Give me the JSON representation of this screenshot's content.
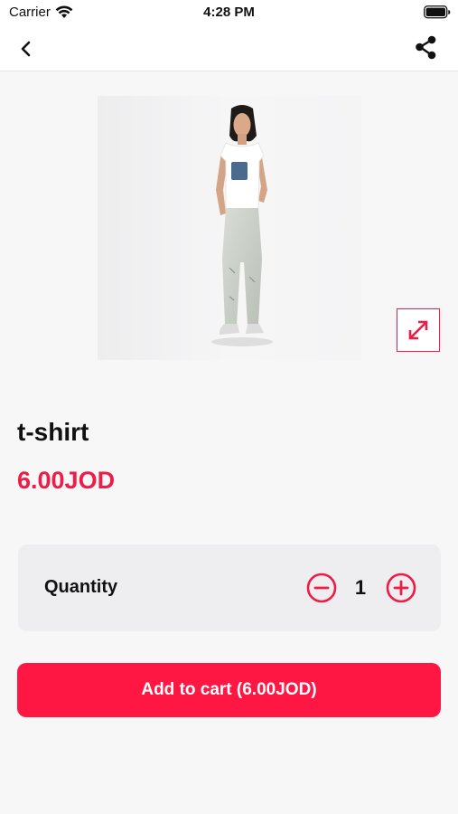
{
  "status_bar": {
    "carrier": "Carrier",
    "time": "4:28 PM",
    "icons": [
      "wifi-icon",
      "battery-icon"
    ]
  },
  "nav": {
    "back_icon": "chevron-left-icon",
    "share_icon": "share-icon"
  },
  "product": {
    "image": "model wearing white t-shirt with denim pocket and light ripped jeans",
    "expand_icon": "expand-arrows-icon",
    "title": "t-shirt",
    "price": "6.00JOD"
  },
  "quantity": {
    "label": "Quantity",
    "value": "1",
    "minus_icon": "minus-circle-icon",
    "plus_icon": "plus-circle-icon"
  },
  "cart": {
    "button_label": "Add to cart (6.00JOD)"
  },
  "colors": {
    "accent": "#ee1c47",
    "button": "#ff1744",
    "background": "#f7f7f8",
    "card": "#eeeef0"
  }
}
